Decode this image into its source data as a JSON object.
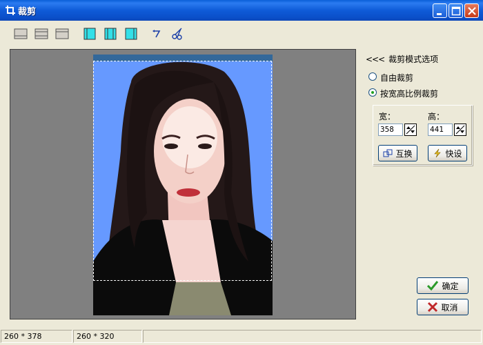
{
  "window": {
    "title": "裁剪",
    "title_icon": "crop-icon",
    "controls": [
      "minimize-icon",
      "maximize-icon",
      "close-icon"
    ]
  },
  "toolbar": {
    "tools": [
      "align-bottom-icon",
      "align-middle-icon",
      "align-top-icon",
      "align-left-icon",
      "align-center-icon",
      "align-right-icon",
      "undo-icon",
      "scissors-icon"
    ]
  },
  "panel": {
    "title_chevrons": "<<<",
    "title": "裁剪模式选项",
    "radio_free": "自由裁剪",
    "radio_ratio": "按宽高比例裁剪",
    "selected_mode": "ratio",
    "width_label": "宽：",
    "width_value": "358",
    "height_label": "高：",
    "height_value": "441",
    "swap_label": "互换",
    "preset_label": "快设"
  },
  "buttons": {
    "ok_label": "确定",
    "cancel_label": "取消"
  },
  "status": {
    "image_size": "260 * 378",
    "crop_size": "260 * 320",
    "extra": ""
  },
  "colors": {
    "titlebar": "#0A5FD8",
    "photo_background": "#6699FF",
    "canvas": "#808080",
    "ok_check": "#2A9A2A",
    "cancel_x": "#C0282A"
  }
}
